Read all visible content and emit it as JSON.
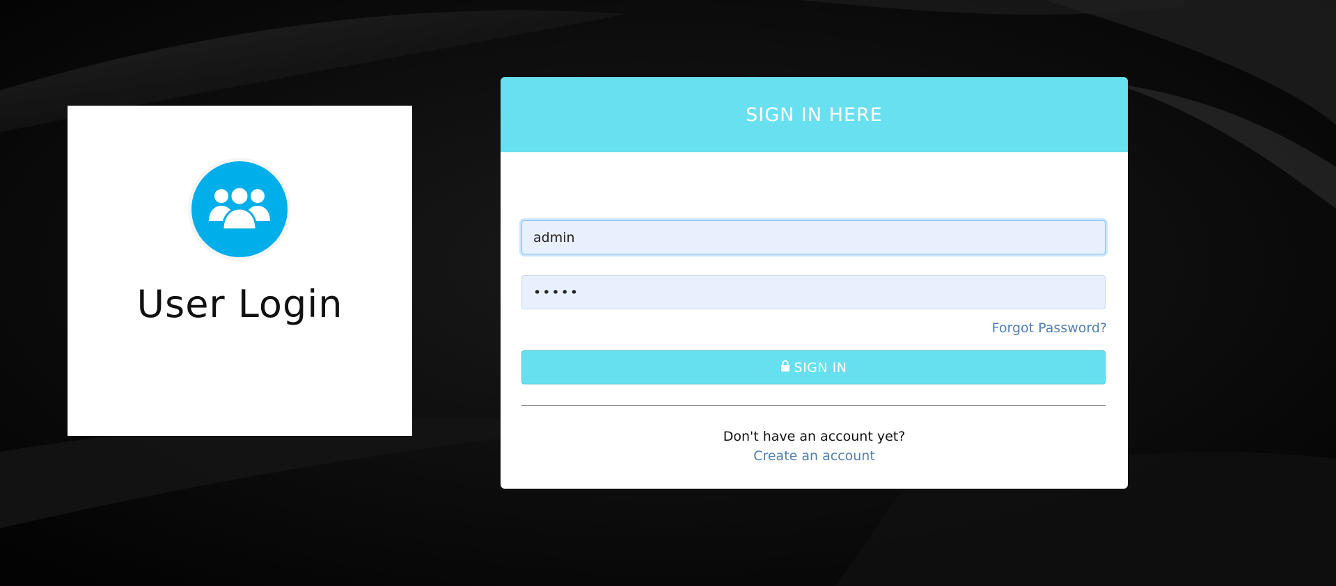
{
  "brand": {
    "icon": "users-group-icon",
    "title": "User Login",
    "accent_color": "#00aeea"
  },
  "signin": {
    "header": "SIGN IN HERE",
    "header_color": "#69e0ef",
    "username_value": "admin",
    "password_value": "•••••",
    "forgot_label": "Forgot Password?",
    "button_icon": "lock-icon",
    "button_label": "SIGN IN",
    "no_account_text": "Don't have an account yet?",
    "create_account_label": "Create an account",
    "link_color": "#4f7fb3"
  }
}
